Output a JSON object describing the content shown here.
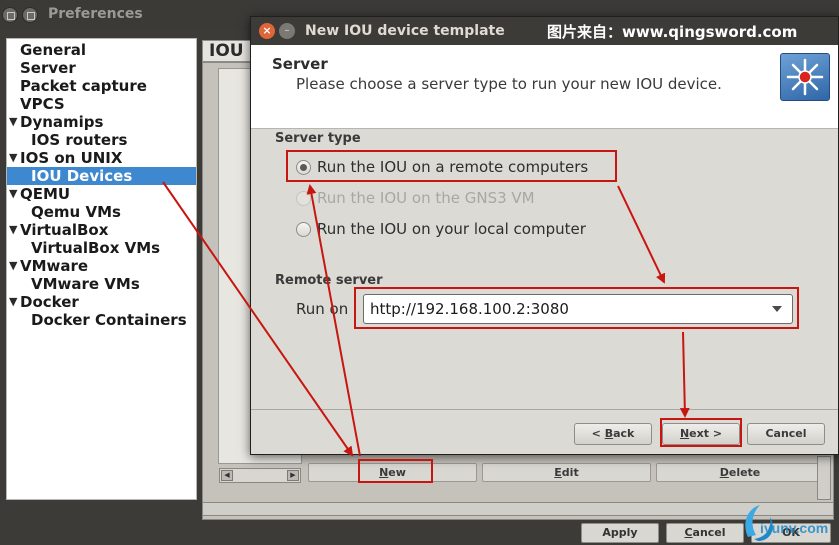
{
  "preferences": {
    "title": "Preferences",
    "nav": [
      {
        "label": "General",
        "level": 0,
        "expandable": false,
        "selected": false
      },
      {
        "label": "Server",
        "level": 0,
        "expandable": false,
        "selected": false
      },
      {
        "label": "Packet capture",
        "level": 0,
        "expandable": false,
        "selected": false
      },
      {
        "label": "VPCS",
        "level": 0,
        "expandable": false,
        "selected": false
      },
      {
        "label": "Dynamips",
        "level": 0,
        "expandable": true,
        "selected": false
      },
      {
        "label": "IOS routers",
        "level": 1,
        "expandable": false,
        "selected": false
      },
      {
        "label": "IOS on UNIX",
        "level": 0,
        "expandable": true,
        "selected": false
      },
      {
        "label": "IOU Devices",
        "level": 1,
        "expandable": false,
        "selected": true
      },
      {
        "label": "QEMU",
        "level": 0,
        "expandable": true,
        "selected": false
      },
      {
        "label": "Qemu VMs",
        "level": 1,
        "expandable": false,
        "selected": false
      },
      {
        "label": "VirtualBox",
        "level": 0,
        "expandable": true,
        "selected": false
      },
      {
        "label": "VirtualBox VMs",
        "level": 1,
        "expandable": false,
        "selected": false
      },
      {
        "label": "VMware",
        "level": 0,
        "expandable": true,
        "selected": false
      },
      {
        "label": "VMware VMs",
        "level": 1,
        "expandable": false,
        "selected": false
      },
      {
        "label": "Docker",
        "level": 0,
        "expandable": true,
        "selected": false
      },
      {
        "label": "Docker Containers",
        "level": 1,
        "expandable": false,
        "selected": false
      }
    ],
    "panel_tab": "IOU",
    "list_buttons": {
      "new": {
        "underline": "N",
        "rest": "ew"
      },
      "edit": {
        "underline": "E",
        "rest": "dit"
      },
      "delete": {
        "underline": "D",
        "rest": "elete"
      }
    },
    "footer_buttons": {
      "apply": "Apply",
      "cancel": {
        "underline": "C",
        "rest": "ancel"
      },
      "ok": "OK"
    }
  },
  "wizard": {
    "title": "New IOU device template",
    "watermark": "图片来自：www.qingsword.com",
    "heading": "Server",
    "subheading": "Please choose a server type to run your new IOU device.",
    "server_type_label": "Server type",
    "server_options": [
      {
        "label": "Run the IOU on a remote computers",
        "checked": true,
        "disabled": false
      },
      {
        "label": "Run the IOU on the GNS3 VM",
        "checked": false,
        "disabled": true
      },
      {
        "label": "Run the IOU on your local computer",
        "checked": false,
        "disabled": false
      }
    ],
    "remote_server_label": "Remote server",
    "run_on_label": "Run on",
    "run_on_value": "http://192.168.100.2:3080",
    "buttons": {
      "back": {
        "prefix": "< ",
        "underline": "B",
        "rest": "ack"
      },
      "next": {
        "underline": "N",
        "rest": "ext >"
      },
      "cancel": "Cancel"
    }
  },
  "brand_logo": {
    "text": "iyunv.com"
  },
  "colors": {
    "highlight": "#c8150f",
    "selection": "#3e88cf",
    "titlebar": "#3c3b37",
    "close_button": "#e1653a"
  }
}
